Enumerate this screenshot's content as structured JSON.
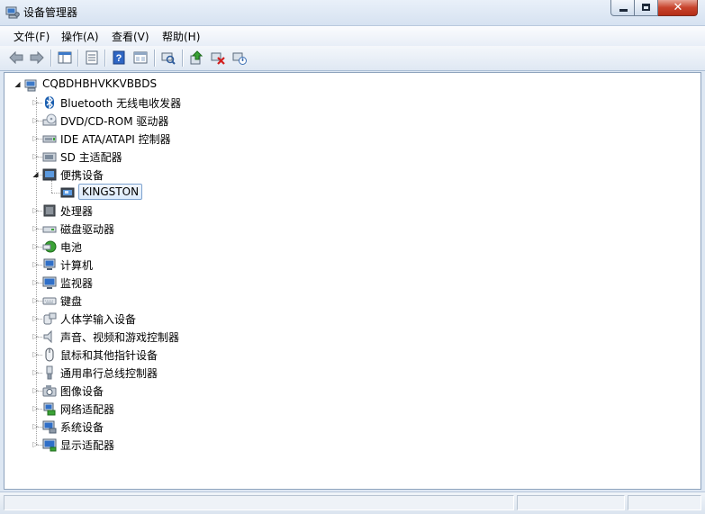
{
  "window": {
    "title": "设备管理器",
    "app_icon": "device-manager-icon",
    "controls": [
      "minimize-icon",
      "maximize-icon",
      "close-icon"
    ]
  },
  "menu": [
    {
      "label": "文件(F)"
    },
    {
      "label": "操作(A)"
    },
    {
      "label": "查看(V)"
    },
    {
      "label": "帮助(H)"
    }
  ],
  "toolbar": {
    "buttons": [
      "back-arrow-icon",
      "forward-arrow-icon",
      "show-hide-tree-icon",
      "properties-icon",
      "help-icon",
      "view-icon",
      "scan-hardware-icon",
      "update-driver-icon",
      "uninstall-icon",
      "disable-icon"
    ]
  },
  "tree": {
    "root": {
      "label": "CQBDHBHVKKVBBDS",
      "icon": "computer-root-icon",
      "expanded": true
    },
    "items": [
      {
        "label": "Bluetooth 无线电收发器",
        "icon": "bluetooth-icon",
        "expanded": false
      },
      {
        "label": "DVD/CD-ROM 驱动器",
        "icon": "dvd-drive-icon",
        "expanded": false
      },
      {
        "label": "IDE ATA/ATAPI 控制器",
        "icon": "ide-controller-icon",
        "expanded": false
      },
      {
        "label": "SD 主适配器",
        "icon": "sd-adapter-icon",
        "expanded": false
      },
      {
        "label": "便携设备",
        "icon": "portable-device-icon",
        "expanded": true,
        "children": [
          {
            "label": "KINGSTON",
            "icon": "kingston-device-icon",
            "selected": true
          }
        ]
      },
      {
        "label": "处理器",
        "icon": "processor-icon",
        "expanded": false
      },
      {
        "label": "磁盘驱动器",
        "icon": "disk-drive-icon",
        "expanded": false
      },
      {
        "label": "电池",
        "icon": "battery-icon",
        "expanded": false
      },
      {
        "label": "计算机",
        "icon": "computer-icon",
        "expanded": false
      },
      {
        "label": "监视器",
        "icon": "monitor-icon",
        "expanded": false
      },
      {
        "label": "键盘",
        "icon": "keyboard-icon",
        "expanded": false
      },
      {
        "label": "人体学输入设备",
        "icon": "hid-icon",
        "expanded": false
      },
      {
        "label": "声音、视频和游戏控制器",
        "icon": "sound-icon",
        "expanded": false
      },
      {
        "label": "鼠标和其他指针设备",
        "icon": "mouse-icon",
        "expanded": false
      },
      {
        "label": "通用串行总线控制器",
        "icon": "usb-icon",
        "expanded": false
      },
      {
        "label": "图像设备",
        "icon": "imaging-device-icon",
        "expanded": false
      },
      {
        "label": "网络适配器",
        "icon": "network-adapter-icon",
        "expanded": false
      },
      {
        "label": "系统设备",
        "icon": "system-device-icon",
        "expanded": false
      },
      {
        "label": "显示适配器",
        "icon": "display-adapter-icon",
        "expanded": false
      }
    ]
  },
  "colors": {
    "selection_border": "#7da2ce",
    "selection_fill": "#dcebfc",
    "window_frame": "#dde7f3",
    "close_button": "#c7432c"
  }
}
